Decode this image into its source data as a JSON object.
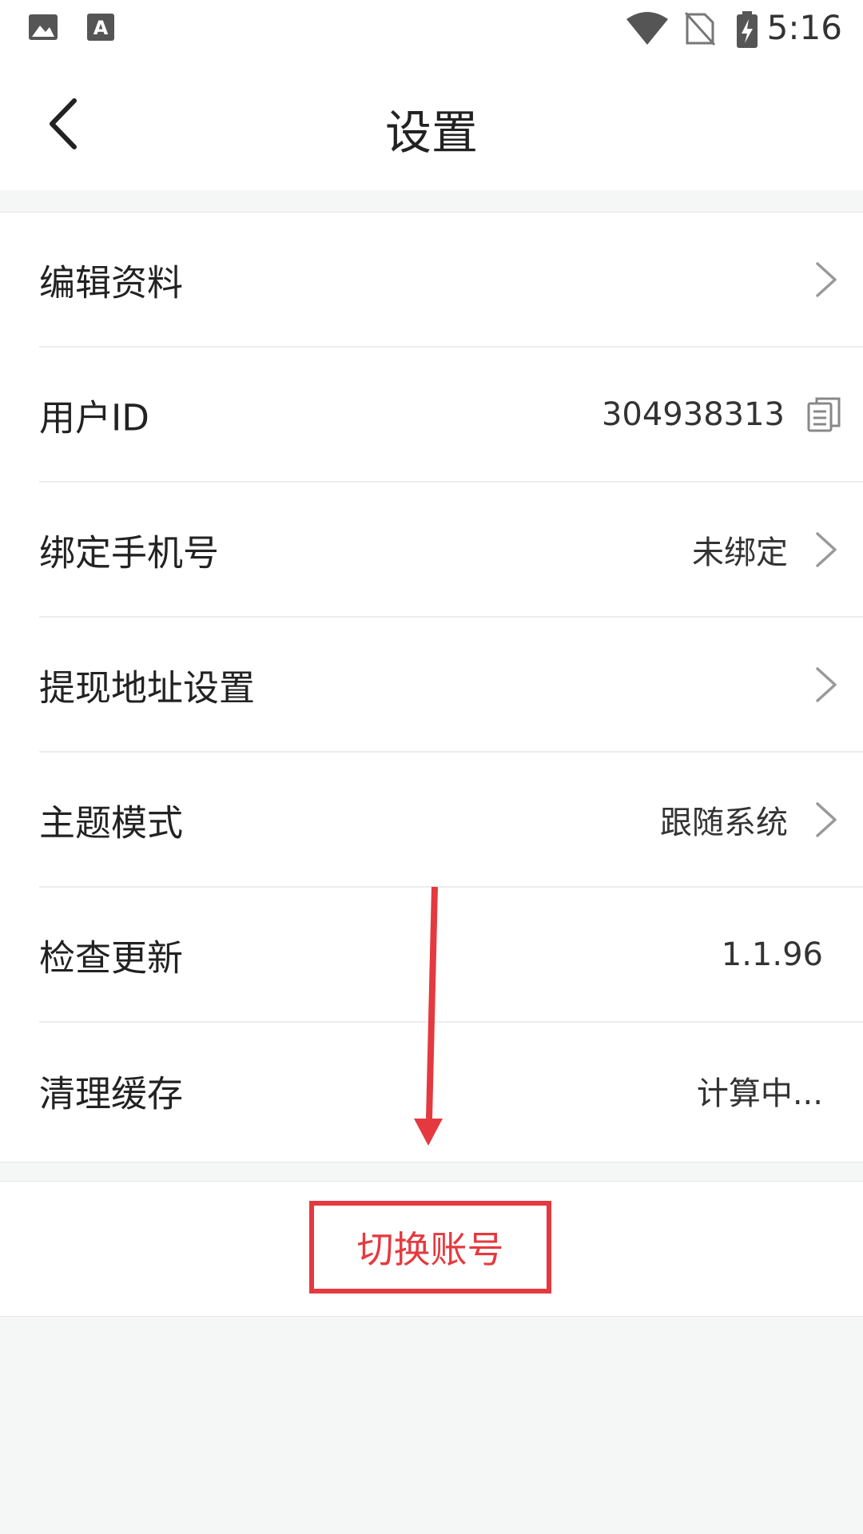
{
  "status_bar": {
    "time": "5:16",
    "icons": [
      "image-icon",
      "font-icon",
      "wifi-icon",
      "no-sim-icon",
      "battery-charging-icon"
    ]
  },
  "header": {
    "title": "设置",
    "back_icon": "chevron-left-icon"
  },
  "settings": {
    "items": [
      {
        "label": "编辑资料",
        "value": "",
        "trailing": "chevron-right-icon"
      },
      {
        "label": "用户ID",
        "value": "304938313",
        "trailing": "copy-icon"
      },
      {
        "label": "绑定手机号",
        "value": "未绑定",
        "trailing": "chevron-right-icon"
      },
      {
        "label": "提现地址设置",
        "value": "",
        "trailing": "chevron-right-icon"
      },
      {
        "label": "主题模式",
        "value": "跟随系统",
        "trailing": "chevron-right-icon"
      },
      {
        "label": "检查更新",
        "value": "1.1.96",
        "trailing": ""
      },
      {
        "label": "清理缓存",
        "value": "计算中...",
        "trailing": ""
      }
    ]
  },
  "switch_account": {
    "label": "切换账号"
  },
  "colors": {
    "accent_red": "#e43a3f",
    "background": "#f5f6f6",
    "card": "#ffffff"
  }
}
